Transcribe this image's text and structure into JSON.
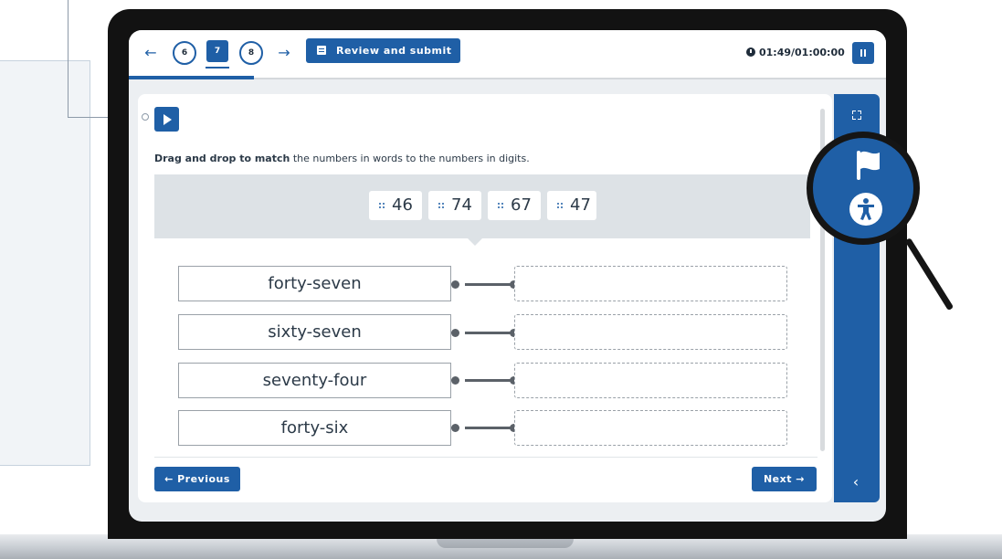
{
  "nav": {
    "back_arrow": "←",
    "forward_arrow": "→",
    "questions": [
      "6",
      "7",
      "8"
    ],
    "current_question": "7",
    "review_label": "Review and submit",
    "timer": "01:49/01:00:00",
    "progress_fraction": 0.165
  },
  "question": {
    "instruction_bold": "Drag and drop to match",
    "instruction_rest": " the numbers in words to the numbers in digits.",
    "chips": [
      "46",
      "74",
      "67",
      "47"
    ],
    "words": [
      "forty-seven",
      "sixty-seven",
      "seventy-four",
      "forty-six"
    ]
  },
  "footer": {
    "previous_label": "← Previous",
    "next_label": "Next →"
  },
  "rail": {
    "collapse_glyph": "‹"
  },
  "colors": {
    "accent": "#1f5fa6",
    "text": "#2c3a48",
    "bezel": "#121212"
  },
  "icons": [
    "play-icon",
    "clock-icon",
    "pause-icon",
    "list-icon",
    "drag-handle-icon",
    "fullscreen-icon",
    "flag-icon",
    "accessibility-icon",
    "chevron-left-icon"
  ]
}
